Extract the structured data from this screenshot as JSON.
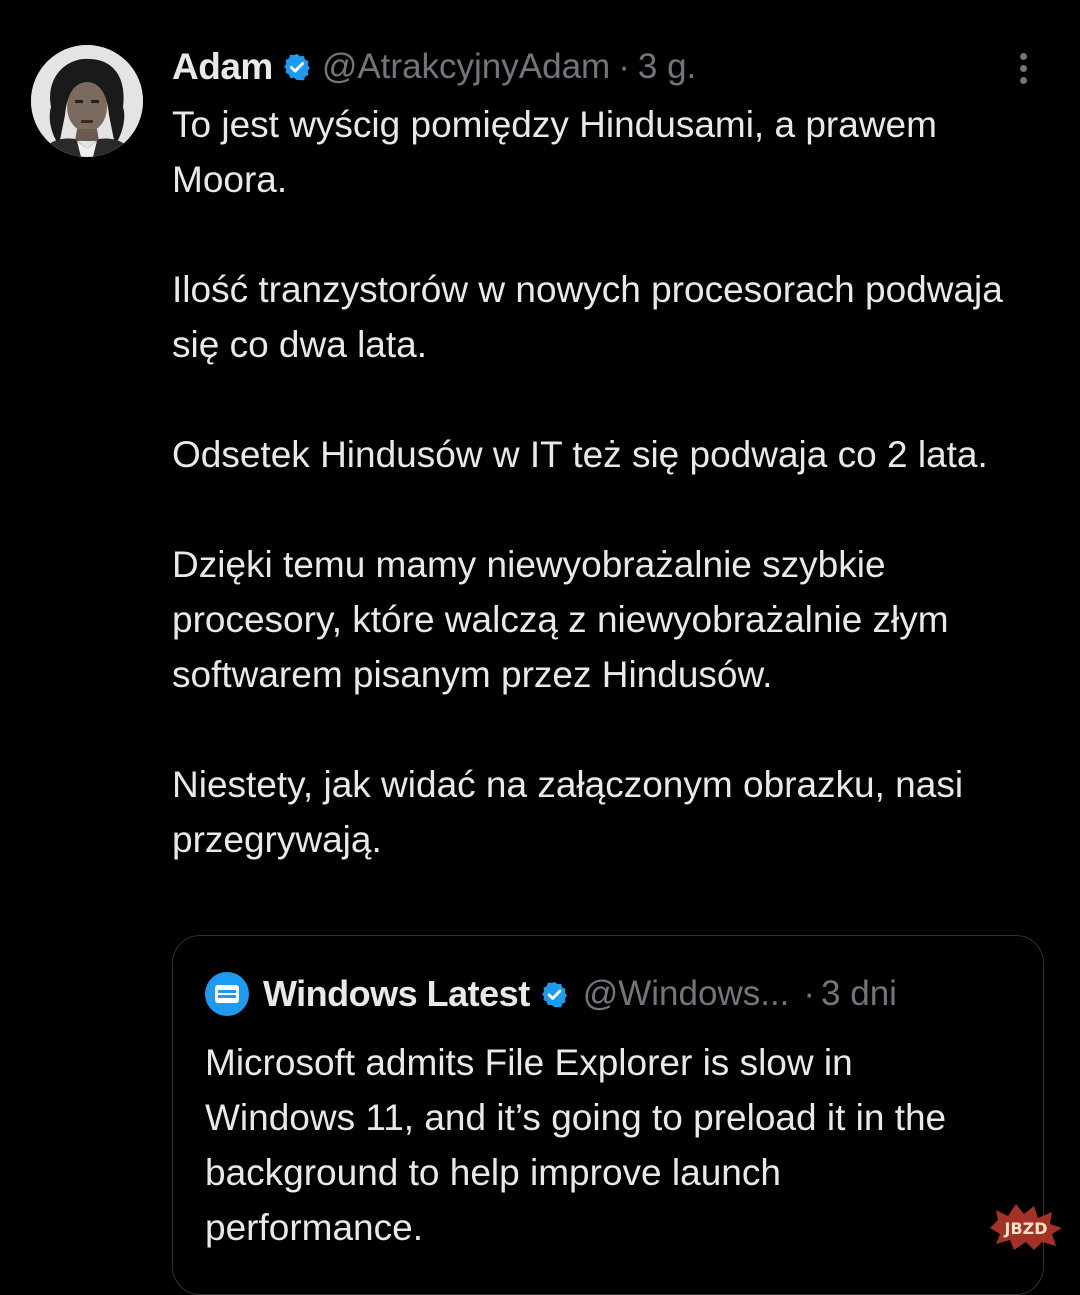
{
  "tweet": {
    "author": {
      "name": "Adam",
      "handle": "@AtrakcyjnyAdam",
      "separator": "·",
      "time": "3 g."
    },
    "paragraphs": [
      "To jest wyścig pomiędzy Hindusami, a prawem Moora.",
      "Ilość tranzystorów w nowych procesorach podwaja się co dwa lata.",
      "Odsetek Hindusów w IT też się podwaja co 2 lata.",
      "Dzięki temu mamy niewyobrażalnie szybkie procesory, które walczą z niewyobrażalnie złym softwarem pisanym przez Hindusów.",
      "Niestety, jak widać na załączonym obrazku, nasi przegrywają."
    ]
  },
  "quoted": {
    "name": "Windows Latest",
    "handle": "@Windows...",
    "separator": "·",
    "time": "3 dni",
    "text": "Microsoft admits File Explorer is slow in Windows 11, and it’s going to preload it in the background to help improve launch performance."
  },
  "watermark": {
    "label": "JBZD"
  },
  "colors": {
    "background": "#000000",
    "text": "#e7e9ea",
    "muted": "#71767b",
    "verified": "#1d9bf0",
    "quote_border": "#2f3336",
    "watermark": "#c0392b"
  }
}
